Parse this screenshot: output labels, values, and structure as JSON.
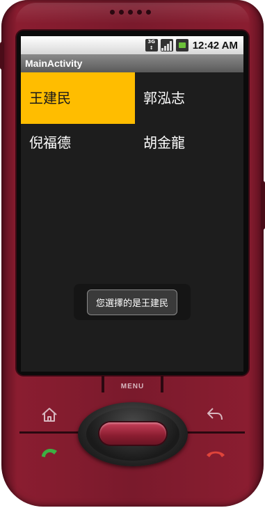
{
  "status_bar": {
    "network_label": "3G",
    "time": "12:42 AM",
    "icons": [
      "3g-icon",
      "signal-icon",
      "battery-icon"
    ]
  },
  "app": {
    "title": "MainActivity"
  },
  "grid": {
    "items": [
      {
        "label": "王建民",
        "selected": true
      },
      {
        "label": "郭泓志",
        "selected": false
      },
      {
        "label": "倪福德",
        "selected": false
      },
      {
        "label": "胡金龍",
        "selected": false
      }
    ]
  },
  "toast": {
    "message": "您選擇的是王建民"
  },
  "hardware": {
    "menu_label": "MENU",
    "buttons": [
      "home-icon",
      "back-icon",
      "call-icon",
      "end-call-icon"
    ]
  },
  "colors": {
    "phone_body": "#7a1a2c",
    "selection": "#ffbd00",
    "screen_bg": "#1d1d1d",
    "call_green": "#3cb043",
    "end_red": "#e0443a"
  }
}
